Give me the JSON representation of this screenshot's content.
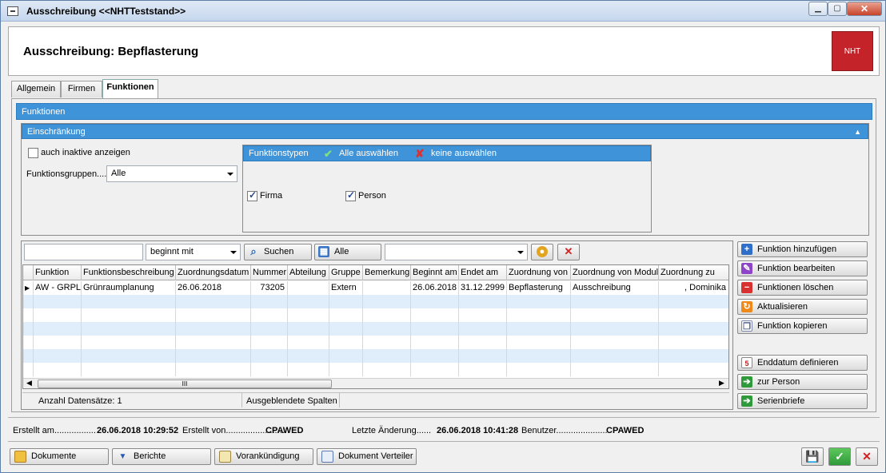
{
  "window": {
    "title": "Ausschreibung  <<NHTTeststand>>"
  },
  "header": {
    "title": "Ausschreibung: Bepflasterung",
    "logo_text": "NHT"
  },
  "tabs": [
    "Allgemein",
    "Firmen",
    "Funktionen"
  ],
  "funktionen_section": "Funktionen",
  "einschraenkung": {
    "title": "Einschränkung",
    "inactive_label": "auch inaktive anzeigen",
    "group_label": "Funktionsgruppen....",
    "group_value": "Alle",
    "types_title": "Funktionstypen",
    "select_all": "Alle auswählen",
    "select_none": "keine auswählen",
    "firma_label": "Firma",
    "person_label": "Person"
  },
  "search": {
    "text_value": "",
    "mode": "beginnt mit",
    "search_button": "Suchen",
    "all_button": "Alle",
    "filter_value": ""
  },
  "grid": {
    "columns": [
      "Funktion",
      "Funktionsbeschreibung",
      "Zuordnungsdatum",
      "Nummer",
      "Abteilung",
      "Gruppe",
      "Bemerkung",
      "Beginnt am",
      "Endet am",
      "Zuordnung von",
      "Zuordnung von Modul",
      "Zuordnung zu"
    ],
    "rows": [
      [
        "AW - GRPL",
        "Grünraumplanung",
        "26.06.2018",
        "73205",
        "",
        "Extern",
        "",
        "26.06.2018",
        "31.12.2999",
        "Bepflasterung",
        "Ausschreibung",
        ", Dominika"
      ]
    ],
    "scroll_thumb": "III"
  },
  "status": {
    "count": "Anzahl Datensätze: 1",
    "hidden": "Ausgeblendete Spalten"
  },
  "actions": [
    "Funktion hinzufügen",
    "Funktion bearbeiten",
    "Funktionen löschen",
    "Aktualisieren",
    "Funktion kopieren",
    "Enddatum definieren",
    "zur Person",
    "Serienbriefe"
  ],
  "info": {
    "created_label": "Erstellt am.................",
    "created_value": "26.06.2018 10:29:52",
    "created_by_label": "Erstellt von.........................",
    "created_by_value": "CPAWED",
    "changed_label": "Letzte Änderung......",
    "changed_value": "26.06.2018 10:41:28",
    "user_label": "Benutzer.....................",
    "user_value": "CPAWED"
  },
  "bottom": [
    "Dokumente",
    "Berichte",
    "Vorankündigung",
    "Dokument Verteiler"
  ],
  "colors": {
    "accent": "#3f93d8",
    "logo": "#c4232a"
  }
}
